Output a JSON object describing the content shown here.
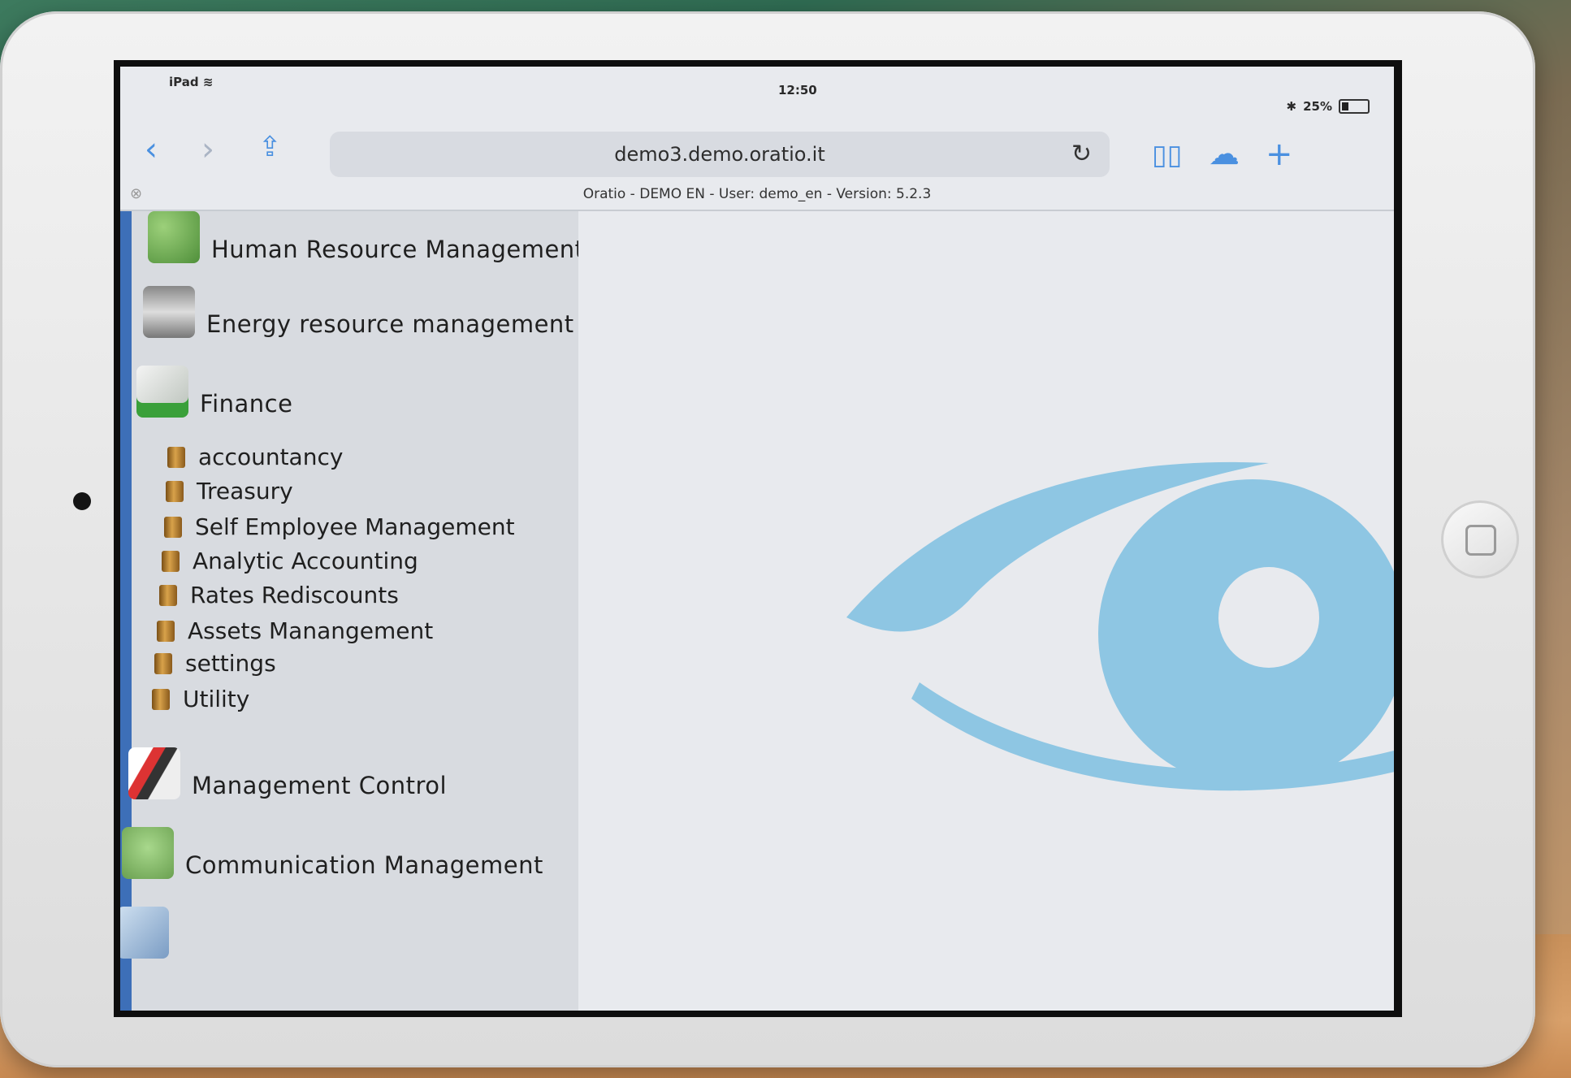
{
  "status_bar": {
    "device": "iPad",
    "time": "12:50",
    "battery": "25%"
  },
  "browser": {
    "url": "demo3.demo.oratio.it",
    "page_title": "Oratio - DEMO EN - User: demo_en - Version: 5.2.3"
  },
  "sidebar": {
    "sections": [
      {
        "label": "Human Resource Management",
        "icon": "people-group-icon"
      },
      {
        "label": "Energy resource management",
        "icon": "database-icon"
      },
      {
        "label": "Finance",
        "icon": "finance-chart-icon"
      },
      {
        "label": "Management Control",
        "icon": "management-chart-icon"
      },
      {
        "label": "Communication Management",
        "icon": "communication-people-icon"
      }
    ],
    "finance_items": [
      "accountancy",
      "Treasury",
      "Self Employee Management",
      "Analytic Accounting",
      "Rates Rediscounts",
      "Assets Manangement",
      "settings",
      "Utility"
    ]
  },
  "colors": {
    "accent": "#3d6fb8",
    "link_blue": "#4a90e0",
    "eye_logo": "#8ec6e3"
  }
}
